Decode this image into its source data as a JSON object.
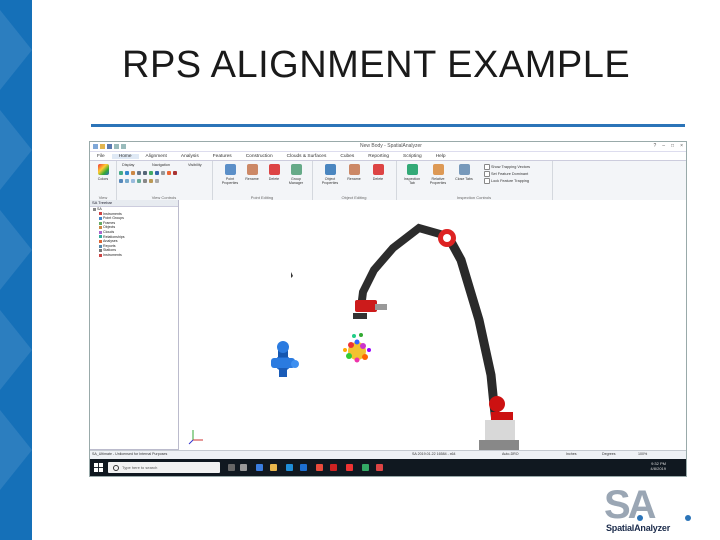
{
  "slide": {
    "title": "RPS ALIGNMENT EXAMPLE",
    "logo_text": "SA",
    "logo_wordmark": "SpatialAnalyzer",
    "accent_color": "#2b74b8",
    "band_color": "#1570b8"
  },
  "app": {
    "window_title": "New Body - SpatialAnalyzer",
    "window_controls": [
      "?",
      "–",
      "□",
      "×"
    ],
    "menu": [
      "File",
      "Home",
      "Alignment",
      "Analysis",
      "Features",
      "Construction",
      "Clouds & Surfaces",
      "Cubes",
      "Reporting",
      "Scripting",
      "Help"
    ],
    "active_menu": "Home",
    "ribbon": {
      "groups": [
        {
          "label": "View",
          "buttons": [
            "Colors"
          ]
        },
        {
          "label": "View Controls",
          "small": [
            "Display",
            "Navigation",
            "Visibility"
          ]
        },
        {
          "label": "Point Editing",
          "buttons": [
            "Point Properties",
            "Rename",
            "Delete",
            "Group Manager"
          ]
        },
        {
          "label": "Object Editing",
          "buttons": [
            "Object Properties",
            "Rename",
            "Delete"
          ]
        },
        {
          "label": "Inspection Controls",
          "buttons": [
            "Inspection Tab",
            "Relative Properties",
            "Close Tabs"
          ],
          "checks": [
            "Show Trapping Vectors",
            "Set Feature Dominant",
            "Lock Feature Trapping"
          ]
        }
      ]
    },
    "tree": {
      "header": "SA Treebar",
      "root": "SA",
      "items": [
        "Instruments",
        "Point Groups",
        "Frames",
        "Objects",
        "Clouds",
        "Relationships",
        "Analyses",
        "Reports",
        "Stations",
        "Instruments"
      ],
      "tabs": [
        "Database",
        "Explorer"
      ]
    },
    "statusbar": {
      "left": "SA_Ultimate - Unlicensed for Internal Purposes",
      "coords": "SA 2019.01.22 16584 - x64",
      "mode": "Auto-DRO",
      "units": "Inches",
      "angle": "Degrees",
      "zoom": "100%"
    },
    "taskbar": {
      "search_placeholder": "Type here to search",
      "time": "9:32 PM",
      "date": "4/8/2019"
    }
  }
}
